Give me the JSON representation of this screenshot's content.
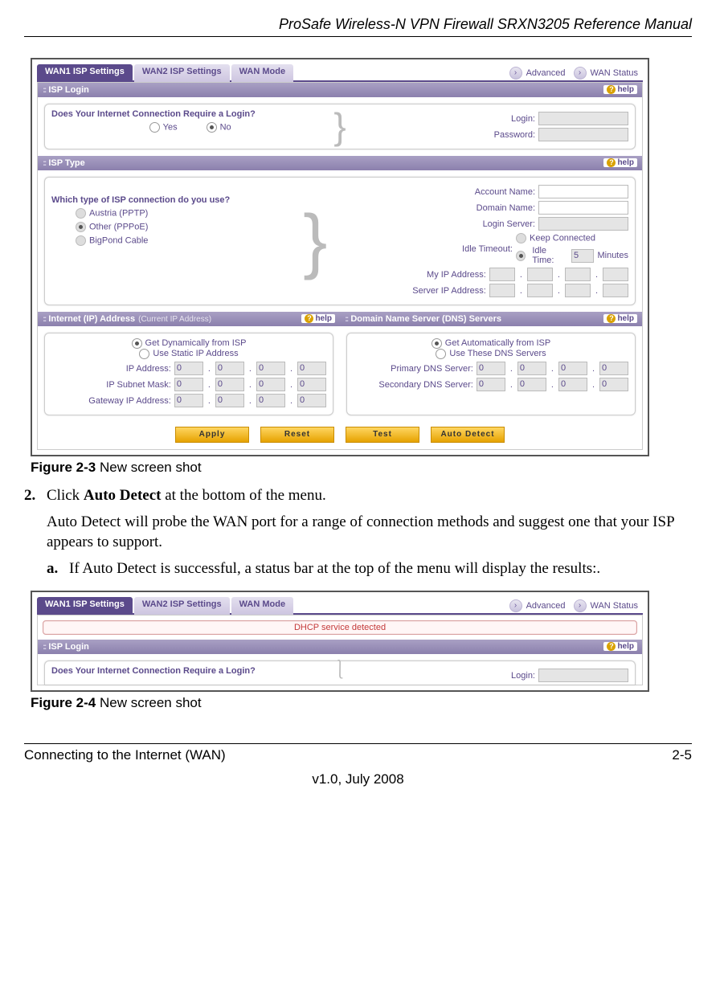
{
  "doc": {
    "header_title": "ProSafe Wireless-N VPN Firewall SRXN3205 Reference Manual",
    "footer_left": "Connecting to the Internet (WAN)",
    "footer_right": "2-5",
    "footer_version": "v1.0, July 2008"
  },
  "figure1_caption_label": "Figure 2-3",
  "figure1_caption_text": " New screen shot",
  "step2_num": "2.",
  "step2_text_prefix": "Click ",
  "step2_text_bold": "Auto Detect",
  "step2_text_suffix": " at the bottom of the menu.",
  "step2_body": "Auto Detect will probe the WAN port for a range of connection methods and suggest one that your ISP appears to support.",
  "sub_a_letter": "a.",
  "sub_a_text": "If Auto Detect is successful, a status bar at the top of the menu will display the results:.",
  "figure2_caption_label": "Figure 2-4",
  "figure2_caption_text": " New screen shot",
  "ui": {
    "tabs": {
      "wan1": "WAN1 ISP Settings",
      "wan2": "WAN2 ISP Settings",
      "mode": "WAN Mode"
    },
    "links": {
      "advanced": "Advanced",
      "wanstatus": "WAN Status"
    },
    "help_label": "help",
    "isp_login": {
      "title": "ISP Login",
      "question": "Does Your Internet Connection Require a Login?",
      "yes": "Yes",
      "no": "No",
      "login_label": "Login:",
      "password_label": "Password:"
    },
    "isp_type": {
      "title": "ISP Type",
      "question": "Which type of ISP connection do you use?",
      "opt1": "Austria (PPTP)",
      "opt2": "Other (PPPoE)",
      "opt3": "BigPond Cable",
      "account_name": "Account Name:",
      "domain_name": "Domain Name:",
      "login_server": "Login Server:",
      "idle_timeout": "Idle Timeout:",
      "keep_connected": "Keep Connected",
      "idle_time_label": "Idle Time:",
      "idle_time_value": "5",
      "minutes": "Minutes",
      "my_ip": "My IP Address:",
      "server_ip": "Server IP Address:"
    },
    "ip_addr": {
      "title": "Internet (IP) Address",
      "subtitle": "(Current IP Address)",
      "get_dyn": "Get Dynamically from ISP",
      "use_static": "Use Static IP Address",
      "ip_label": "IP Address:",
      "mask_label": "IP Subnet Mask:",
      "gateway_label": "Gateway IP Address:",
      "zero": "0"
    },
    "dns": {
      "title": "Domain Name Server (DNS) Servers",
      "get_auto": "Get Automatically from ISP",
      "use_these": "Use These DNS Servers",
      "primary_label": "Primary DNS Server:",
      "secondary_label": "Secondary DNS Server:",
      "zero": "0"
    },
    "buttons": {
      "apply": "Apply",
      "reset": "Reset",
      "test": "Test",
      "autodetect": "Auto Detect"
    },
    "status_strip": "DHCP service detected"
  }
}
